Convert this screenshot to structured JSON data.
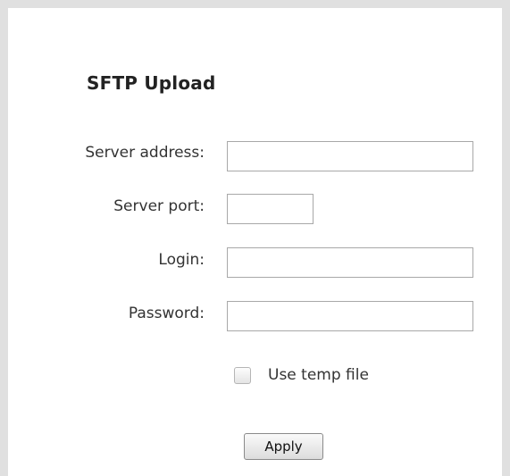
{
  "panel": {
    "title": "SFTP Upload"
  },
  "form": {
    "server_address": {
      "label": "Server address:",
      "value": "",
      "placeholder": ""
    },
    "server_port": {
      "label": "Server port:",
      "value": "",
      "placeholder": ""
    },
    "login": {
      "label": "Login:",
      "value": "",
      "placeholder": ""
    },
    "password": {
      "label": "Password:",
      "value": "",
      "placeholder": ""
    },
    "use_temp_file": {
      "label": "Use temp file",
      "checked": false
    }
  },
  "actions": {
    "apply_label": "Apply"
  }
}
